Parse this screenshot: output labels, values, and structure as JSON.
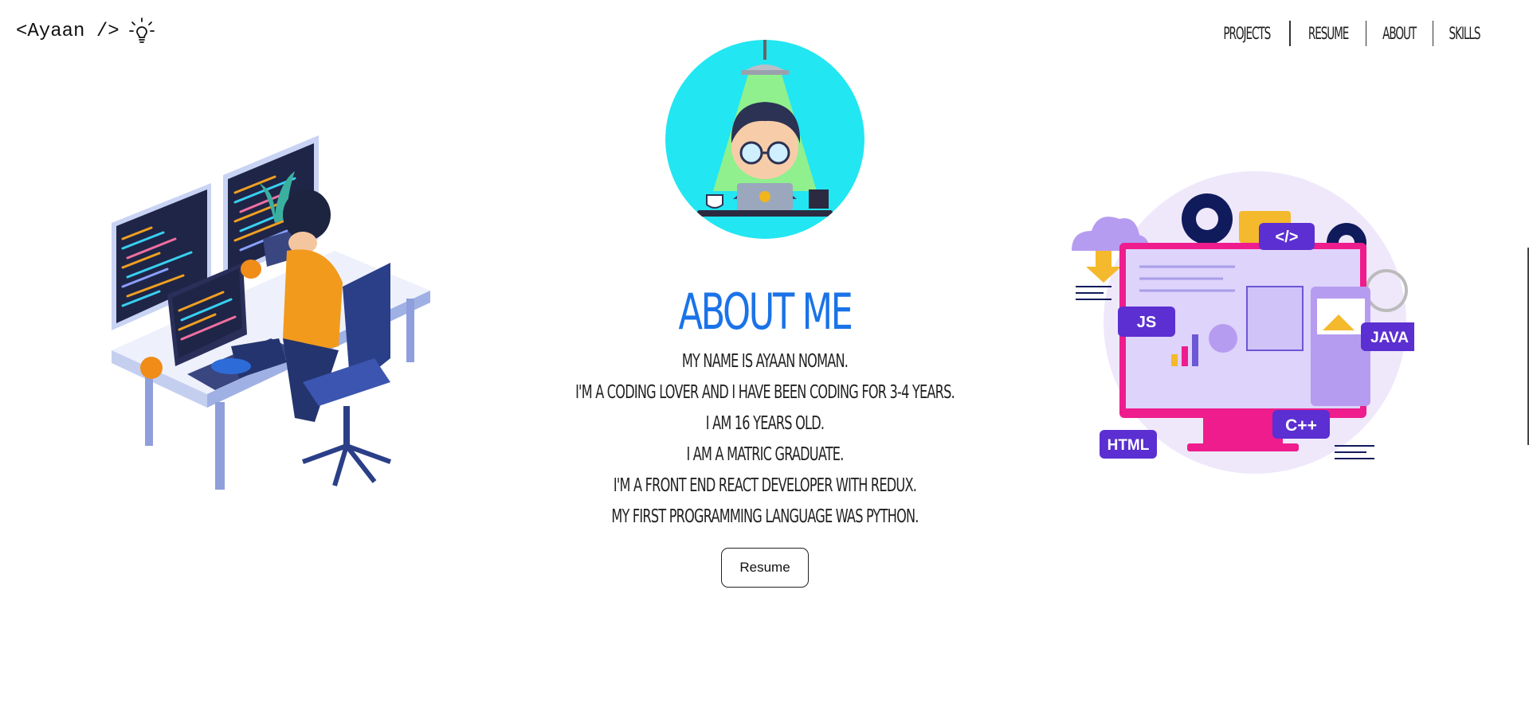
{
  "header": {
    "logo_text": "<Ayaan />",
    "logo_icon": "lightbulb-icon"
  },
  "nav": {
    "items": [
      {
        "label": "PROJECTS"
      },
      {
        "label": "RESUME"
      },
      {
        "label": "ABOUT"
      },
      {
        "label": "SKILLS"
      }
    ]
  },
  "about": {
    "title": "ABOUT ME",
    "lines": [
      "MY NAME IS AYAAN NOMAN.",
      "I'M A CODING LOVER AND I HAVE BEEN CODING FOR 3-4 YEARS.",
      "I AM 16 YEARS OLD.",
      "I AM A MATRIC GRADUATE.",
      "I'M A FRONT END REACT DEVELOPER WITH REDUX.",
      "MY FIRST PROGRAMMING LANGUAGE WAS PYTHON."
    ],
    "button_label": "Resume"
  },
  "illustration_right": {
    "badges": [
      "JS",
      "</>",
      "JAVA",
      "HTML",
      "C++"
    ]
  },
  "colors": {
    "accent_blue": "#1a73e8",
    "avatar_bg": "#22e6f2",
    "monitor_pink": "#ee1c8d",
    "badge_purple": "#5b2fd1"
  }
}
